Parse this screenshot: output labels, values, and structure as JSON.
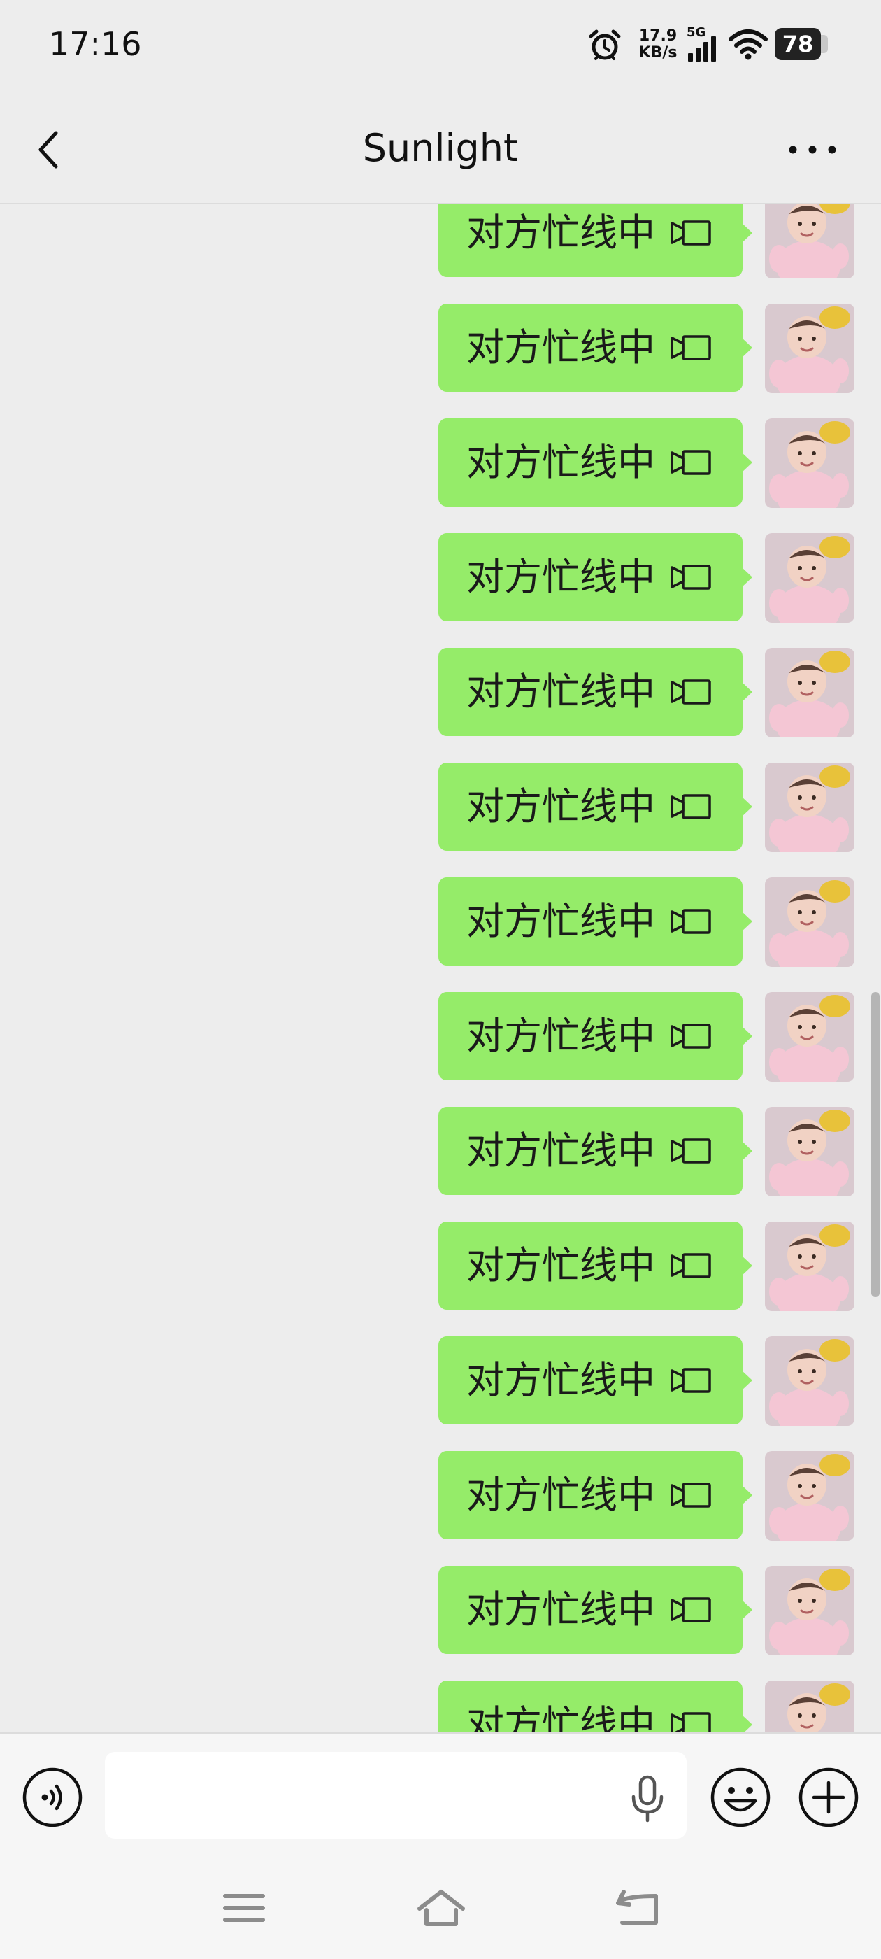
{
  "status_bar": {
    "time": "17:16",
    "speed_value": "17.9",
    "speed_unit": "KB/s",
    "network": "5G",
    "battery": "78",
    "icons": [
      "alarm-icon",
      "signal-icon",
      "wifi-icon",
      "battery-icon"
    ]
  },
  "header": {
    "title": "Sunlight",
    "back_icon": "chevron-left-icon",
    "more_icon": "more-dots-icon"
  },
  "messages": [
    {
      "text": "对方忙线中",
      "icon": "video-call-icon",
      "sender": "me"
    },
    {
      "text": "对方忙线中",
      "icon": "video-call-icon",
      "sender": "me"
    },
    {
      "text": "对方忙线中",
      "icon": "video-call-icon",
      "sender": "me"
    },
    {
      "text": "对方忙线中",
      "icon": "video-call-icon",
      "sender": "me"
    },
    {
      "text": "对方忙线中",
      "icon": "video-call-icon",
      "sender": "me"
    },
    {
      "text": "对方忙线中",
      "icon": "video-call-icon",
      "sender": "me"
    },
    {
      "text": "对方忙线中",
      "icon": "video-call-icon",
      "sender": "me"
    },
    {
      "text": "对方忙线中",
      "icon": "video-call-icon",
      "sender": "me"
    },
    {
      "text": "对方忙线中",
      "icon": "video-call-icon",
      "sender": "me"
    },
    {
      "text": "对方忙线中",
      "icon": "video-call-icon",
      "sender": "me"
    },
    {
      "text": "对方忙线中",
      "icon": "video-call-icon",
      "sender": "me"
    },
    {
      "text": "对方忙线中",
      "icon": "video-call-icon",
      "sender": "me"
    },
    {
      "text": "对方忙线中",
      "icon": "video-call-icon",
      "sender": "me"
    },
    {
      "text": "对方忙线中",
      "icon": "video-call-icon",
      "sender": "me"
    }
  ],
  "input_bar": {
    "value": "",
    "icons": [
      "voice-icon",
      "mic-icon",
      "emoji-icon",
      "plus-icon"
    ]
  },
  "system_nav": {
    "icons": [
      "menu-icon",
      "home-icon",
      "back-icon"
    ]
  },
  "colors": {
    "background": "#ededed",
    "bubble": "#95ec69",
    "bar": "#f6f6f6"
  }
}
